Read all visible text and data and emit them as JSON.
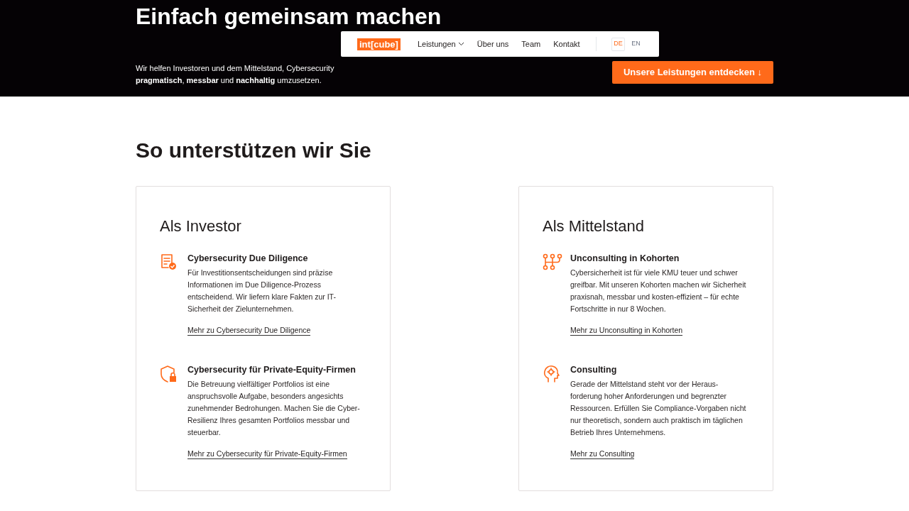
{
  "hero": {
    "title": "Einfach gemeinsam machen",
    "subtitle": "Wir helfen Investoren und dem Mittelstand, Cybersecurity **pragmatisch**, **messbar** und **nachhaltig** umzusetzen.",
    "cta": "Unsere Leistungen entdecken ↓"
  },
  "nav": {
    "logo": "int[cube]",
    "items": [
      {
        "label": "Leistungen",
        "kind": "dropdown"
      },
      {
        "label": "Über uns",
        "kind": "link"
      },
      {
        "label": "Team",
        "kind": "link"
      },
      {
        "label": "Kontakt",
        "kind": "link"
      }
    ],
    "languages": [
      {
        "label": "DE",
        "selected": true
      },
      {
        "label": "EN",
        "selected": false
      }
    ]
  },
  "section": {
    "title": "So unterstützen wir Sie",
    "cards": [
      {
        "title": "Als Investor",
        "services": [
          {
            "kind": "document",
            "title": "Cybersecurity Due Diligence",
            "text": "Für Investitionsentscheidungen sind präzise Informationen im Due Diligence-Prozess entscheidend. Wir liefern klare Fakten zur IT-Sicherheit der Zielunternehmen.",
            "link": "Mehr zu Cybersecurity Due Diligence"
          },
          {
            "kind": "shield",
            "title": "Cybersecurity für Private-Equity-Firmen",
            "text": "Die Betreuung vielfältiger Portfolios ist eine anspruchsvolle Aufgabe, besonders angesichts zunehmender Bedrohungen. Machen Sie die Cyber-Resilienz Ihres gesamten Portfolios messbar und steuerbar.",
            "link": "Mehr zu Cybersecurity für Private-Equity-Firmen"
          }
        ]
      },
      {
        "title": "Als Mittelstand",
        "services": [
          {
            "kind": "network",
            "title": "Unconsulting in Kohorten",
            "text": "Cybersicherheit ist für viele KMU teuer und schwer greifbar. Mit unseren Kohorten machen wir Sicherheit praxisnah, messbar und kosten-effizient – für echte Fortschritte in nur 8 Wochen.",
            "link": "Mehr zu Unconsulting in Kohorten"
          },
          {
            "kind": "head",
            "title": "Consulting",
            "text": "Gerade der Mittelstand steht vor der Heraus-forderung hoher Anforderungen und begrenzter Ressourcen. Erfüllen Sie Compliance-Vorgaben nicht nur theoretisch, sondern auch praktisch im täglichen Betrieb Ihres Unternehmens.",
            "link": "Mehr zu Consulting"
          }
        ]
      }
    ]
  }
}
